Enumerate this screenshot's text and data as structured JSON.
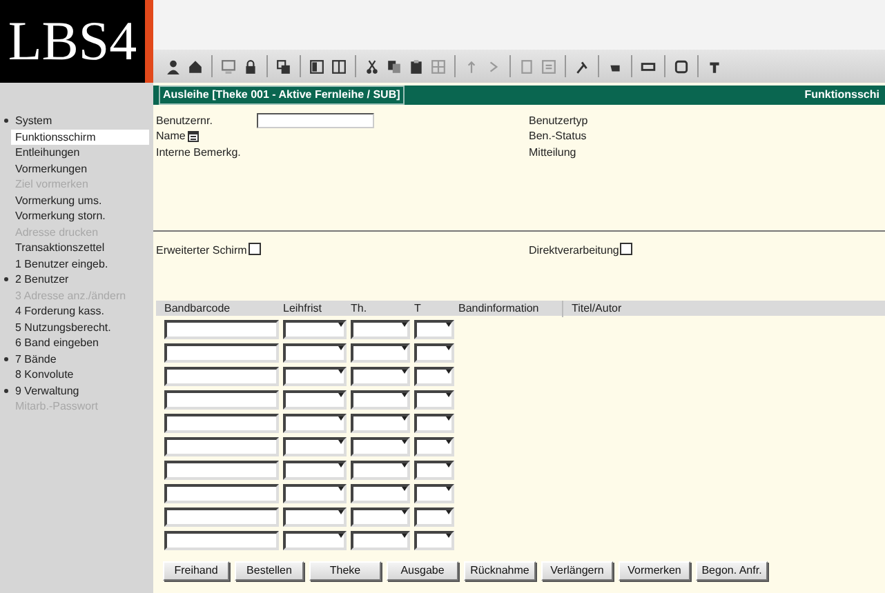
{
  "logo": {
    "text": "LBS4"
  },
  "title_bar": {
    "title": "Ausleihe [Theke 001 - Aktive Fernleihe / SUB]",
    "right_text": "Funktionsschi"
  },
  "sidebar": {
    "items": [
      {
        "label": "System",
        "marked": true,
        "selected": false,
        "disabled": false
      },
      {
        "label": "Funktionsschirm",
        "marked": false,
        "selected": true,
        "disabled": false
      },
      {
        "label": "Entleihungen",
        "marked": false,
        "selected": false,
        "disabled": false
      },
      {
        "label": "Vormerkungen",
        "marked": false,
        "selected": false,
        "disabled": false
      },
      {
        "label": "Ziel vormerken",
        "marked": false,
        "selected": false,
        "disabled": true
      },
      {
        "label": "Vormerkung ums.",
        "marked": false,
        "selected": false,
        "disabled": false
      },
      {
        "label": "Vormerkung storn.",
        "marked": false,
        "selected": false,
        "disabled": false
      },
      {
        "label": "Adresse drucken",
        "marked": false,
        "selected": false,
        "disabled": true
      },
      {
        "label": "Transaktionszettel",
        "marked": false,
        "selected": false,
        "disabled": false
      },
      {
        "label": "1 Benutzer eingeb.",
        "marked": false,
        "selected": false,
        "disabled": false
      },
      {
        "label": "2 Benutzer",
        "marked": true,
        "selected": false,
        "disabled": false
      },
      {
        "label": "3 Adresse anz./ändern",
        "marked": false,
        "selected": false,
        "disabled": true
      },
      {
        "label": "4 Forderung kass.",
        "marked": false,
        "selected": false,
        "disabled": false
      },
      {
        "label": "5 Nutzungsberecht.",
        "marked": false,
        "selected": false,
        "disabled": false
      },
      {
        "label": "6 Band eingeben",
        "marked": false,
        "selected": false,
        "disabled": false
      },
      {
        "label": "7 Bände",
        "marked": true,
        "selected": false,
        "disabled": false
      },
      {
        "label": "8 Konvolute",
        "marked": false,
        "selected": false,
        "disabled": false
      },
      {
        "label": "9 Verwaltung",
        "marked": true,
        "selected": false,
        "disabled": false
      },
      {
        "label": "Mitarb.-Passwort",
        "marked": false,
        "selected": false,
        "disabled": true
      }
    ]
  },
  "user_panel": {
    "user_number_label": "Benutzernr.",
    "user_type_label": "Benutzertyp",
    "name_label": "Name",
    "status_label": "Ben.-Status",
    "remark_label": "Interne Bemerkg.",
    "message_label": "Mitteilung"
  },
  "options": [
    {
      "label": "Erweiterter Schirm",
      "checked": false
    },
    {
      "label": "Direktverarbeitung",
      "checked": false
    }
  ],
  "table": {
    "columns": [
      {
        "label": "Bandbarcode",
        "kind": "text"
      },
      {
        "label": "Leihfrist",
        "kind": "dropdown"
      },
      {
        "label": "Th.",
        "kind": "dropdown"
      },
      {
        "label": "T",
        "kind": "dropdown"
      },
      {
        "label": "Bandinformation",
        "kind": "info"
      },
      {
        "label": "Titel/Autor",
        "kind": "info"
      }
    ],
    "rows": [
      {
        "kind": "entry"
      },
      {
        "kind": "entry"
      },
      {
        "kind": "entry"
      },
      {
        "kind": "entry"
      },
      {
        "kind": "entry"
      },
      {
        "kind": "entry"
      },
      {
        "kind": "entry"
      },
      {
        "kind": "entry"
      },
      {
        "kind": "entry"
      },
      {
        "kind": "entry"
      }
    ]
  },
  "buttons": [
    "Freihand",
    "Bestellen",
    "Theke",
    "Ausgabe",
    "Rücknahme",
    "Verlängern",
    "Vormerken",
    "Begon. Anfr."
  ]
}
